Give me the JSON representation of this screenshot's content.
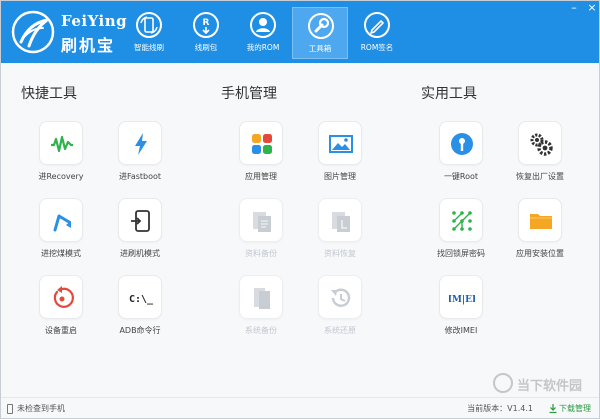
{
  "app": {
    "brand_en": "FeiYing",
    "brand_cn": "刷机宝"
  },
  "nav": [
    {
      "label": "智能线刷",
      "icon": "sync-icon",
      "active": false
    },
    {
      "label": "线刷包",
      "icon": "rom-package-icon",
      "active": false
    },
    {
      "label": "我的ROM",
      "icon": "user-icon",
      "active": false
    },
    {
      "label": "工具箱",
      "icon": "wrench-icon",
      "active": true
    },
    {
      "label": "ROM签名",
      "icon": "pen-icon",
      "active": false
    }
  ],
  "sections": [
    {
      "title": "快捷工具",
      "tiles": [
        {
          "label": "进Recovery",
          "icon": "recovery-icon",
          "enabled": true
        },
        {
          "label": "进Fastboot",
          "icon": "lightning-icon",
          "enabled": true
        },
        {
          "label": "进挖煤模式",
          "icon": "digger-icon",
          "enabled": true
        },
        {
          "label": "进刷机模式",
          "icon": "phone-enter-icon",
          "enabled": true
        },
        {
          "label": "设备重启",
          "icon": "restart-icon",
          "enabled": true
        },
        {
          "label": "ADB命令行",
          "icon": "terminal-icon",
          "enabled": true
        }
      ]
    },
    {
      "title": "手机管理",
      "tiles": [
        {
          "label": "应用管理",
          "icon": "apps-icon",
          "enabled": true
        },
        {
          "label": "图片管理",
          "icon": "picture-icon",
          "enabled": true
        },
        {
          "label": "资料备份",
          "icon": "backup-icon",
          "enabled": false
        },
        {
          "label": "资料恢复",
          "icon": "restore-file-icon",
          "enabled": false
        },
        {
          "label": "系统备份",
          "icon": "system-backup-icon",
          "enabled": false
        },
        {
          "label": "系统还原",
          "icon": "history-icon",
          "enabled": false
        }
      ]
    },
    {
      "title": "实用工具",
      "tiles": [
        {
          "label": "一键Root",
          "icon": "key-icon",
          "enabled": true
        },
        {
          "label": "恢复出厂设置",
          "icon": "gears-icon",
          "enabled": true
        },
        {
          "label": "找回锁屏密码",
          "icon": "pattern-lock-icon",
          "enabled": true
        },
        {
          "label": "应用安装位置",
          "icon": "folder-icon",
          "enabled": true
        },
        {
          "label": "修改IMEI",
          "icon": "imei-icon",
          "enabled": true
        }
      ]
    }
  ],
  "status": {
    "connection": "未检查到手机",
    "version": "当前版本：V1.4.1",
    "download": "下载管理"
  },
  "watermark": "当下软件园",
  "colors": {
    "header": "#1f8fe5",
    "active_tab": "#4da8ef",
    "green": "#2eb34a",
    "blue": "#2a8fe6",
    "orange": "#f5a623",
    "red": "#e5483b",
    "disabled": "#c8ccd3"
  }
}
